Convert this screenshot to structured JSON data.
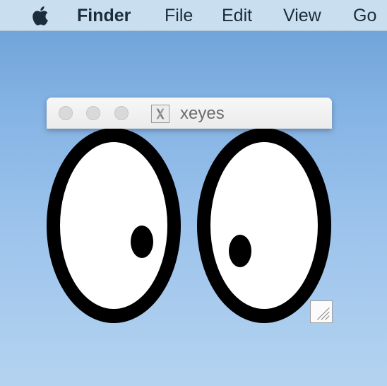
{
  "menubar": {
    "apple_icon": "apple-logo-icon",
    "app_name": "Finder",
    "items": [
      {
        "label": "File"
      },
      {
        "label": "Edit"
      },
      {
        "label": "View"
      },
      {
        "label": "Go"
      }
    ]
  },
  "window": {
    "title": "xeyes",
    "app_icon": "x11-icon",
    "buttons": [
      "close",
      "minimize",
      "zoom"
    ]
  },
  "colors": {
    "menubar_bg": "#c9dff0",
    "desktop_top": "#6a9fd6",
    "desktop_bottom": "#b4d3f0",
    "traffic_inactive": "#d9d9d9",
    "eye_outline": "#000000",
    "eye_white": "#ffffff"
  }
}
